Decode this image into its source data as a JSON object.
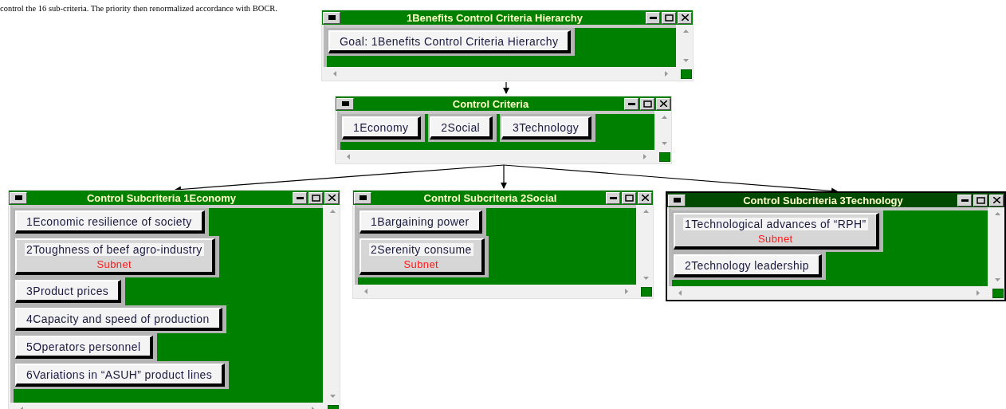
{
  "caption": "control the 16 sub-criteria. The priority then renormalized accordance with BOCR.",
  "windows": [
    {
      "title": "1Benefits Control Criteria Hierarchy",
      "active": false,
      "kind": "column",
      "nodes": [
        {
          "label": "Goal: 1Benefits Control Criteria Hierarchy"
        }
      ]
    },
    {
      "title": "Control Criteria",
      "active": false,
      "kind": "row",
      "nodes": [
        {
          "label": "1Economy"
        },
        {
          "label": "2Social"
        },
        {
          "label": "3Technology"
        }
      ]
    },
    {
      "title": "Control Subcriteria 1Economy",
      "active": false,
      "kind": "column",
      "nodes": [
        {
          "label": "1Economic resilience of society"
        },
        {
          "label": "2Toughness of beef agro-industry",
          "subnet": "Subnet"
        },
        {
          "label": "3Product prices"
        },
        {
          "label": "4Capacity and speed of production"
        },
        {
          "label": "5Operators personnel"
        },
        {
          "label": "6Variations in “ASUH” product lines"
        }
      ]
    },
    {
      "title": "Control Subcriteria 2Social",
      "active": false,
      "kind": "column",
      "nodes": [
        {
          "label": "1Bargaining power"
        },
        {
          "label": "2Serenity consume",
          "subnet": "Subnet"
        }
      ]
    },
    {
      "title": "Control Subcriteria 3Technology",
      "active": true,
      "kind": "column",
      "nodes": [
        {
          "label": "1Technological advances of “RPH”",
          "subnet": "Subnet"
        },
        {
          "label": "2Technology leadership"
        }
      ]
    }
  ]
}
